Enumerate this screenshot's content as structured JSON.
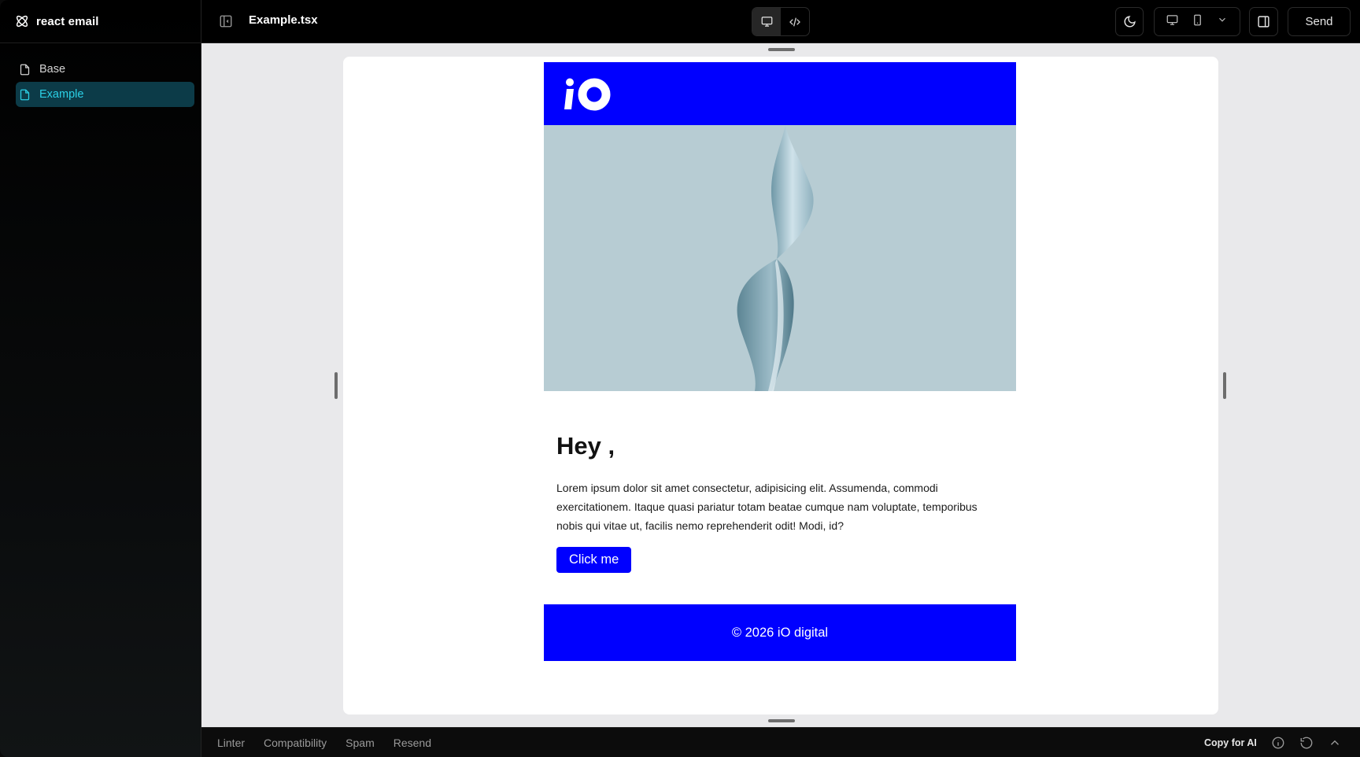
{
  "sidebar": {
    "brand": "react email",
    "items": [
      {
        "label": "Base",
        "active": false
      },
      {
        "label": "Example",
        "active": true
      }
    ]
  },
  "topbar": {
    "file_title": "Example.tsx",
    "send_label": "Send"
  },
  "email": {
    "greeting": "Hey ,",
    "body": "Lorem ipsum dolor sit amet consectetur, adipisicing elit. Assumenda, commodi exercitationem. Itaque quasi pariatur totam beatae cumque nam voluptate, temporibus nobis qui vitae ut, facilis nemo reprehenderit odit! Modi, id?",
    "button_label": "Click me",
    "footer": "© 2026 iO digital",
    "brand_color": "#0000ff"
  },
  "bottombar": {
    "tabs": [
      "Linter",
      "Compatibility",
      "Spam",
      "Resend"
    ],
    "copy_ai": "Copy for AI"
  },
  "colors": {
    "accent_active_bg": "#0c3b48",
    "accent_active_text": "#2bd0e6"
  }
}
